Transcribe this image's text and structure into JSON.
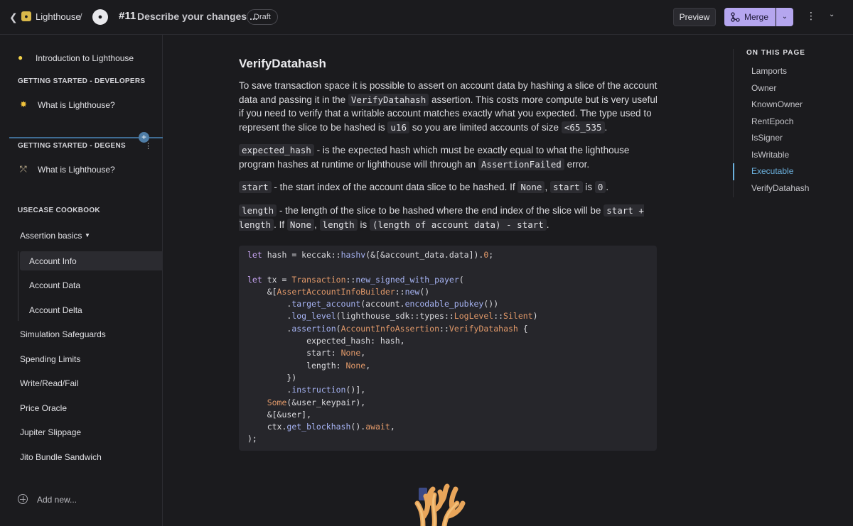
{
  "header": {
    "space_name": "Lighthouse",
    "separator": "/",
    "pr_number": "#11",
    "pr_title": "Describe your changes ...",
    "draft_label": "Draft",
    "preview_label": "Preview",
    "merge_label": "Merge"
  },
  "sidebar": {
    "intro": "Introduction to Lighthouse",
    "section_devs": "GETTING STARTED - DEVELOPERS",
    "devs_item": "What is Lighthouse?",
    "section_degens": "GETTING STARTED - DEGENS",
    "degens_item": "What is Lighthouse?",
    "section_cookbook": "USECASE COOKBOOK",
    "assertion_basics": "Assertion basics",
    "sub_items": [
      "Account Info",
      "Account Data",
      "Account Delta"
    ],
    "items": [
      "Simulation Safeguards",
      "Spending Limits",
      "Write/Read/Fail",
      "Price Oracle",
      "Jupiter Slippage",
      "Jito Bundle Sandwich"
    ],
    "add_new": "Add new..."
  },
  "content": {
    "heading": "VerifyDatahash",
    "p1": {
      "a": "To save transaction space it is possible to assert on account data by hashing a slice of the account data and passing it in the ",
      "code1": "VerifyDatahash",
      "b": " assertion. This costs more compute but is very useful if you need to verify that a writable account matches exactly what you expected.  The type used to represent the slice to be hashed is ",
      "code2": "u16",
      "c": " so you are limited accounts of size ",
      "code3": "<65_535",
      "d": "."
    },
    "p2": {
      "code1": "expected_hash",
      "a": " - is the expected hash which must be exactly equal to what the lighthouse program hashes at runtime or lighthouse will through an ",
      "code2": "AssertionFailed",
      "b": " error."
    },
    "p3": {
      "code1": "start",
      "a": " - the start index of the account data slice to be hashed. If ",
      "code2": "None",
      "b": ", ",
      "code3": "start",
      "c": " is ",
      "code4": "0",
      "d": "."
    },
    "p4": {
      "code1": "length",
      "a": " - the length of the slice to be hashed where the end index of the slice will be ",
      "code2": "start + length",
      "b": ". If ",
      "code3": "None",
      "c": ", ",
      "code4": "length",
      "d": " is ",
      "code5": "(length of account data) - start",
      "e": "."
    }
  },
  "toc": {
    "title": "ON THIS PAGE",
    "items": [
      "Lamports",
      "Owner",
      "KnownOwner",
      "RentEpoch",
      "IsSigner",
      "IsWritable",
      "Executable",
      "VerifyDatahash"
    ],
    "active": "Executable"
  },
  "colors": {
    "accent": "#b5a6ef",
    "toc_active": "#6bb0dd",
    "divider": "#3f6c93"
  }
}
